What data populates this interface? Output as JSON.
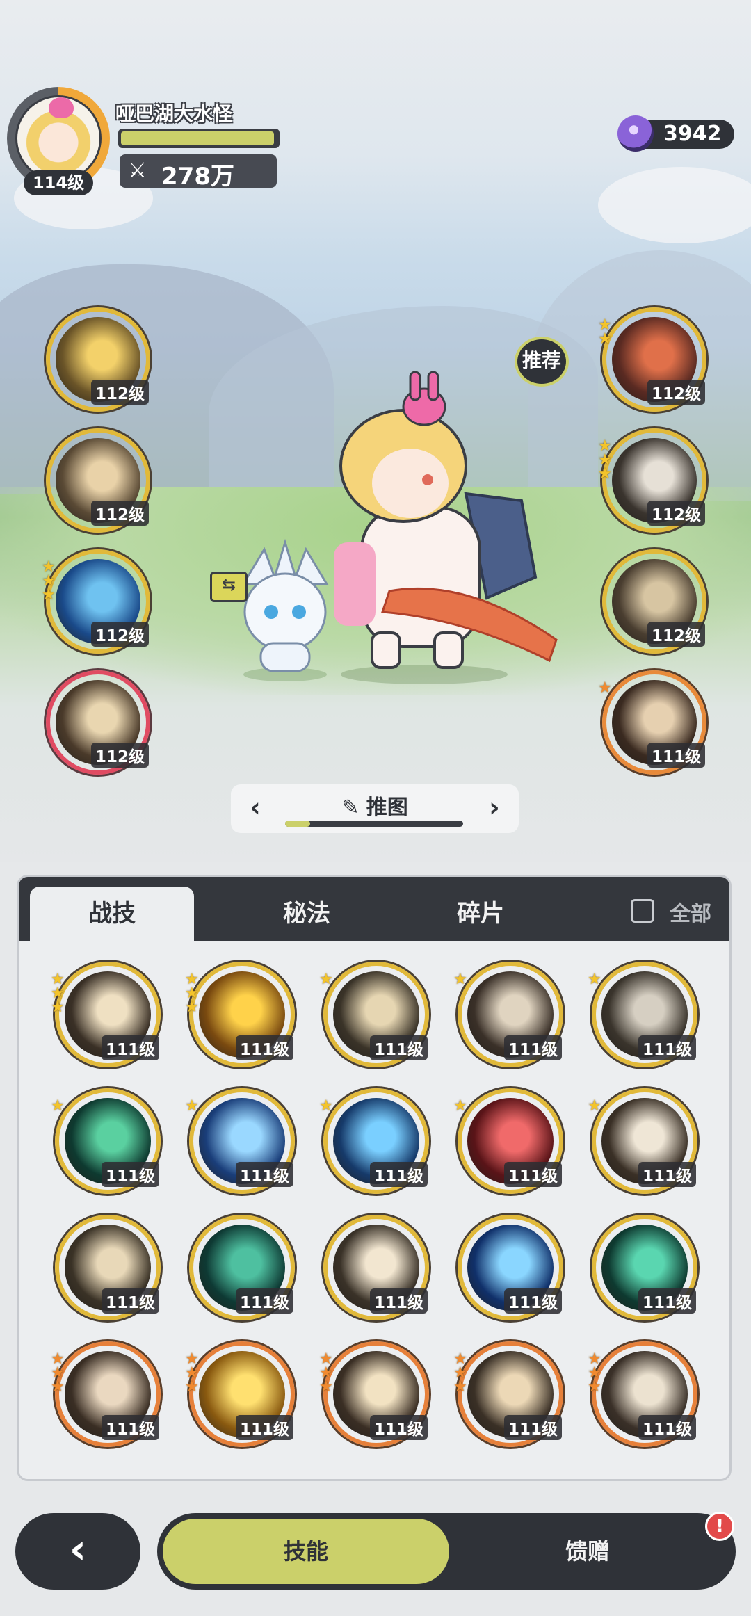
{
  "player": {
    "name": "哑巴湖大水怪",
    "level": "114级",
    "power": "278万",
    "exp_fraction": 0.98
  },
  "currency": {
    "gems": "3942",
    "icon": "gem-icon"
  },
  "recommend_label": "推荐",
  "equipped_left": [
    {
      "level": "112级",
      "stars": 0,
      "rarity": "gold",
      "art": [
        "#6a5428",
        "#f3d16a"
      ]
    },
    {
      "level": "112级",
      "stars": 0,
      "rarity": "gold",
      "art": [
        "#5a4a35",
        "#e9d2a8"
      ]
    },
    {
      "level": "112级",
      "stars": 3,
      "rarity": "gold",
      "art": [
        "#1a4a8a",
        "#6fc2f0"
      ]
    },
    {
      "level": "112级",
      "stars": 0,
      "rarity": "red",
      "art": [
        "#4a3a2a",
        "#e9d6b0"
      ]
    }
  ],
  "equipped_right": [
    {
      "level": "112级",
      "stars": 2,
      "rarity": "gold",
      "art": [
        "#5a2a22",
        "#e0704a"
      ]
    },
    {
      "level": "112级",
      "stars": 3,
      "rarity": "gold",
      "art": [
        "#3a342e",
        "#e6e0d6"
      ]
    },
    {
      "level": "112级",
      "stars": 0,
      "rarity": "gold",
      "art": [
        "#4a3e30",
        "#d7c5a2"
      ]
    },
    {
      "level": "111级",
      "stars": 1,
      "rarity": "orange",
      "art": [
        "#3a2a20",
        "#e6d0b0"
      ]
    }
  ],
  "loadout": {
    "name": "推图",
    "progress": 0.14,
    "edit_icon": "pencil-icon"
  },
  "tabs": [
    {
      "label": "战技",
      "active": true
    },
    {
      "label": "秘法",
      "active": false
    },
    {
      "label": "碎片",
      "active": false
    }
  ],
  "filter_all_label": "全部",
  "skills": [
    {
      "level": "111级",
      "stars": 3,
      "rarity": "gold",
      "art": [
        "#3a3026",
        "#efe0c2"
      ]
    },
    {
      "level": "111级",
      "stars": 3,
      "rarity": "gold",
      "art": [
        "#7a4a10",
        "#ffd24a"
      ]
    },
    {
      "level": "111级",
      "stars": 1,
      "rarity": "gold",
      "art": [
        "#3a3328",
        "#e6d6b2"
      ]
    },
    {
      "level": "111级",
      "stars": 1,
      "rarity": "gold",
      "art": [
        "#3a3028",
        "#e0d4c0"
      ]
    },
    {
      "level": "111级",
      "stars": 1,
      "rarity": "gold",
      "art": [
        "#3a342c",
        "#d6cfc2"
      ]
    },
    {
      "level": "111级",
      "stars": 1,
      "rarity": "gold",
      "art": [
        "#0e3a30",
        "#5ad0a0"
      ]
    },
    {
      "level": "111级",
      "stars": 1,
      "rarity": "gold",
      "art": [
        "#1a3e7a",
        "#9ad8ff"
      ]
    },
    {
      "level": "111级",
      "stars": 1,
      "rarity": "gold",
      "art": [
        "#163a6a",
        "#7acfff"
      ]
    },
    {
      "level": "111级",
      "stars": 1,
      "rarity": "gold",
      "art": [
        "#5a1418",
        "#f06a6a"
      ]
    },
    {
      "level": "111级",
      "stars": 1,
      "rarity": "gold",
      "art": [
        "#3a3026",
        "#efe6d6"
      ]
    },
    {
      "level": "111级",
      "stars": 0,
      "rarity": "gold",
      "art": [
        "#3a3226",
        "#e8d8b8"
      ]
    },
    {
      "level": "111级",
      "stars": 0,
      "rarity": "gold",
      "art": [
        "#0e3a34",
        "#4ec0a0"
      ]
    },
    {
      "level": "111级",
      "stars": 0,
      "rarity": "gold",
      "art": [
        "#3a3228",
        "#f2e6d0"
      ]
    },
    {
      "level": "111级",
      "stars": 0,
      "rarity": "gold",
      "art": [
        "#10306a",
        "#8ad6ff"
      ]
    },
    {
      "level": "111级",
      "stars": 0,
      "rarity": "gold",
      "art": [
        "#0e3a30",
        "#5ad6b0"
      ]
    },
    {
      "level": "111级",
      "stars": 3,
      "rarity": "orange",
      "art": [
        "#3a2e24",
        "#ead8c0"
      ]
    },
    {
      "level": "111级",
      "stars": 3,
      "rarity": "orange",
      "art": [
        "#8a5a10",
        "#ffe070"
      ]
    },
    {
      "level": "111级",
      "stars": 3,
      "rarity": "orange",
      "art": [
        "#3a2e24",
        "#f2e2c2"
      ]
    },
    {
      "level": "111级",
      "stars": 3,
      "rarity": "orange",
      "art": [
        "#3a3026",
        "#ecd8b6"
      ]
    },
    {
      "level": "111级",
      "stars": 3,
      "rarity": "orange",
      "art": [
        "#3a3028",
        "#ece2d0"
      ]
    }
  ],
  "nav": {
    "skill_label": "技能",
    "gift_label": "馈赠",
    "gift_alert": "!"
  }
}
